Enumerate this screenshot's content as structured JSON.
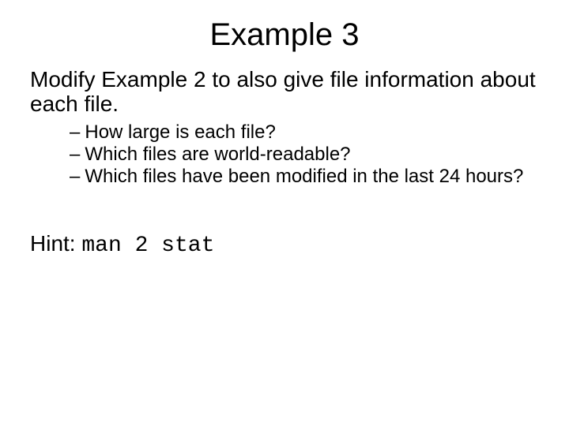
{
  "title": "Example 3",
  "lead": "Modify Example 2 to also give file information about each file.",
  "bullets": [
    "How large is each file?",
    "Which files are world-readable?",
    "Which files have been modified in the last 24 hours?"
  ],
  "hint_label": "Hint: ",
  "hint_code": "man 2 stat"
}
